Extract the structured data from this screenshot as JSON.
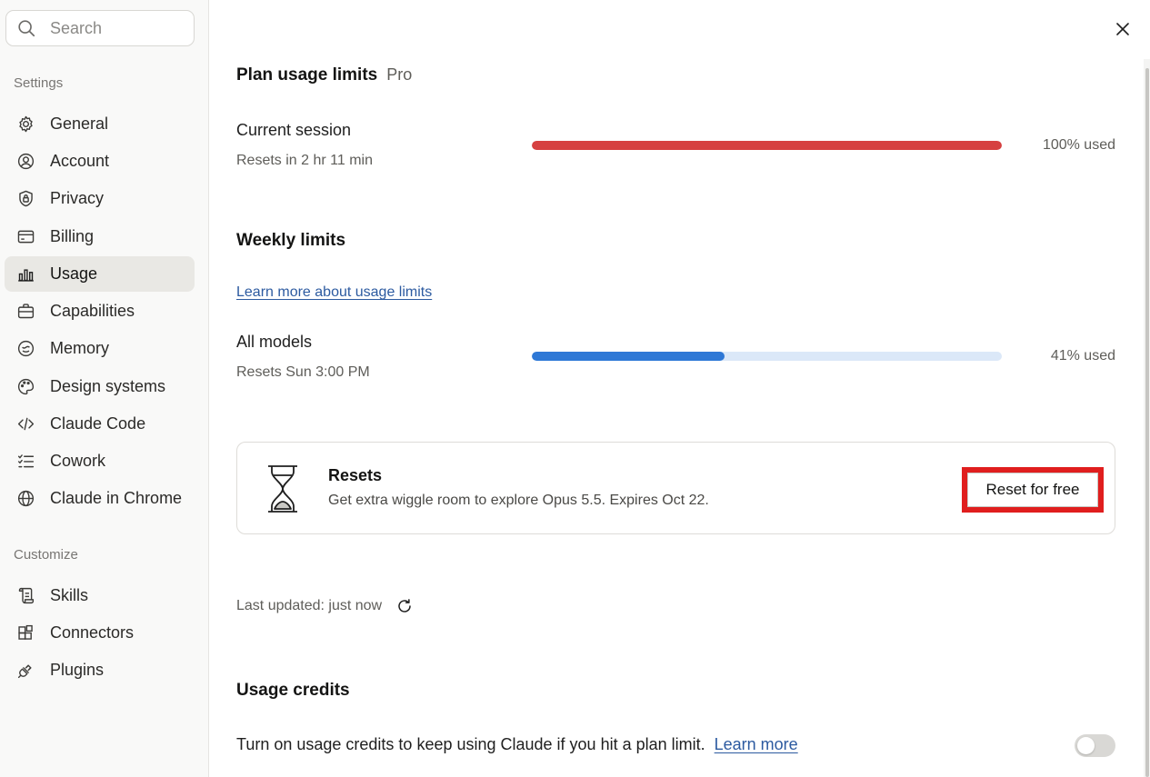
{
  "search": {
    "placeholder": "Search"
  },
  "sidebar": {
    "settings_label": "Settings",
    "customize_label": "Customize",
    "settings_items": [
      {
        "label": "General",
        "icon": "gear-icon"
      },
      {
        "label": "Account",
        "icon": "user-circle-icon"
      },
      {
        "label": "Privacy",
        "icon": "shield-lock-icon"
      },
      {
        "label": "Billing",
        "icon": "credit-card-icon"
      },
      {
        "label": "Usage",
        "icon": "bar-chart-icon",
        "active": true
      },
      {
        "label": "Capabilities",
        "icon": "briefcase-icon"
      },
      {
        "label": "Memory",
        "icon": "memory-icon"
      },
      {
        "label": "Design systems",
        "icon": "palette-icon"
      },
      {
        "label": "Claude Code",
        "icon": "code-icon"
      },
      {
        "label": "Cowork",
        "icon": "checklist-icon"
      },
      {
        "label": "Claude in Chrome",
        "icon": "globe-icon"
      }
    ],
    "customize_items": [
      {
        "label": "Skills",
        "icon": "scroll-icon"
      },
      {
        "label": "Connectors",
        "icon": "blocks-icon"
      },
      {
        "label": "Plugins",
        "icon": "plug-icon"
      }
    ]
  },
  "main": {
    "title": "Plan usage limits",
    "plan": "Pro",
    "current_session": {
      "title": "Current session",
      "sub": "Resets in 2 hr 11 min",
      "used_text": "100% used",
      "fraction": 1.0,
      "color": "#d64040"
    },
    "weekly": {
      "heading": "Weekly limits",
      "learn_link": "Learn more about usage limits",
      "all_models": {
        "title": "All models",
        "sub": "Resets Sun 3:00 PM",
        "used_text": "41% used",
        "fraction": 0.41,
        "color": "#2e78d6"
      }
    },
    "resets_card": {
      "icon": "hourglass-icon",
      "title": "Resets",
      "desc": "Get extra wiggle room to explore Opus 5.5. Expires Oct 22.",
      "button": "Reset for free"
    },
    "last_updated": "Last updated: just now",
    "credits": {
      "heading": "Usage credits",
      "desc": "Turn on usage credits to keep using Claude if you hit a plan limit.",
      "link": "Learn more",
      "toggle_on": false
    }
  }
}
